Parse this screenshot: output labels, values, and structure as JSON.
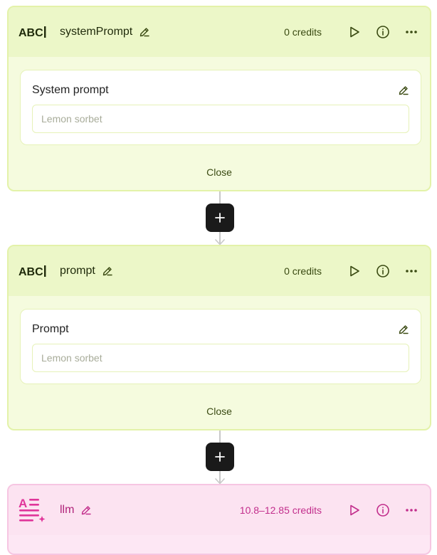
{
  "nodes": [
    {
      "name": "systemPrompt",
      "credits": "0 credits",
      "card_title": "System prompt",
      "input_placeholder": "Lemon sorbet",
      "close_label": "Close"
    },
    {
      "name": "prompt",
      "credits": "0 credits",
      "card_title": "Prompt",
      "input_placeholder": "Lemon sorbet",
      "close_label": "Close"
    },
    {
      "name": "llm",
      "credits": "10.8–12.85 credits"
    }
  ],
  "icons": {
    "text_type": "text-type-abc-icon",
    "llm_type": "llm-text-generation-icon",
    "edit": "pencil-icon",
    "run": "play-icon",
    "info": "info-icon",
    "more": "more-dots-icon",
    "add": "plus-icon"
  },
  "colors": {
    "text_node_bg": "#f5fbde",
    "text_node_border": "#e3f2a9",
    "llm_node_bg": "#fde7f4",
    "llm_accent": "#e0359a",
    "dark_text": "#1f2a0a",
    "add_button": "#1a1a1a"
  }
}
